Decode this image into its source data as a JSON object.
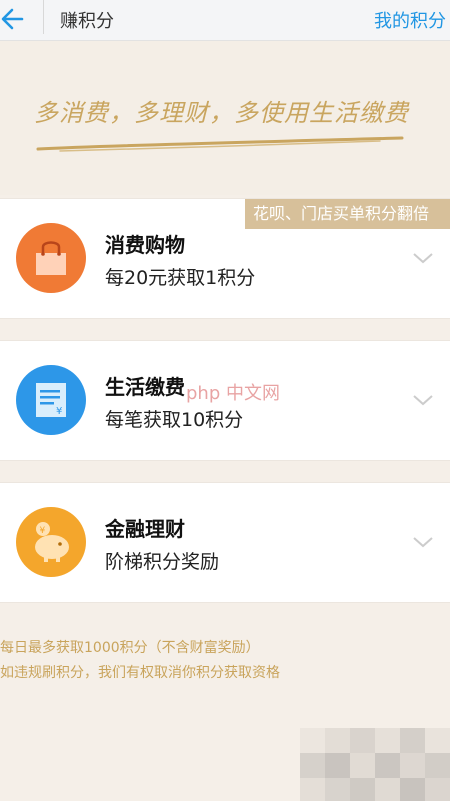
{
  "topbar": {
    "title": "赚积分",
    "right_link": "我的积分"
  },
  "banner": {
    "slogan": "多消费，多理财，多使用生活缴费"
  },
  "cards": [
    {
      "title": "消费购物",
      "subtitle": "每20元获取1积分",
      "badge": "花呗、门店买单积分翻倍"
    },
    {
      "title": "生活缴费",
      "subtitle": "每笔获取10积分"
    },
    {
      "title": "金融理财",
      "subtitle": "阶梯积分奖励"
    }
  ],
  "rules": [
    "每日最多获取1000积分（不含财富奖励）",
    "如违规刷积分，我们有权取消你积分获取资格"
  ],
  "watermark": "php 中文网",
  "colors": {
    "accent_blue": "#2196e3",
    "gold": "#c9a55f",
    "shopping_orange": "#f07a35",
    "utility_blue": "#2d97e8",
    "finance_orange": "#f4a62c"
  }
}
